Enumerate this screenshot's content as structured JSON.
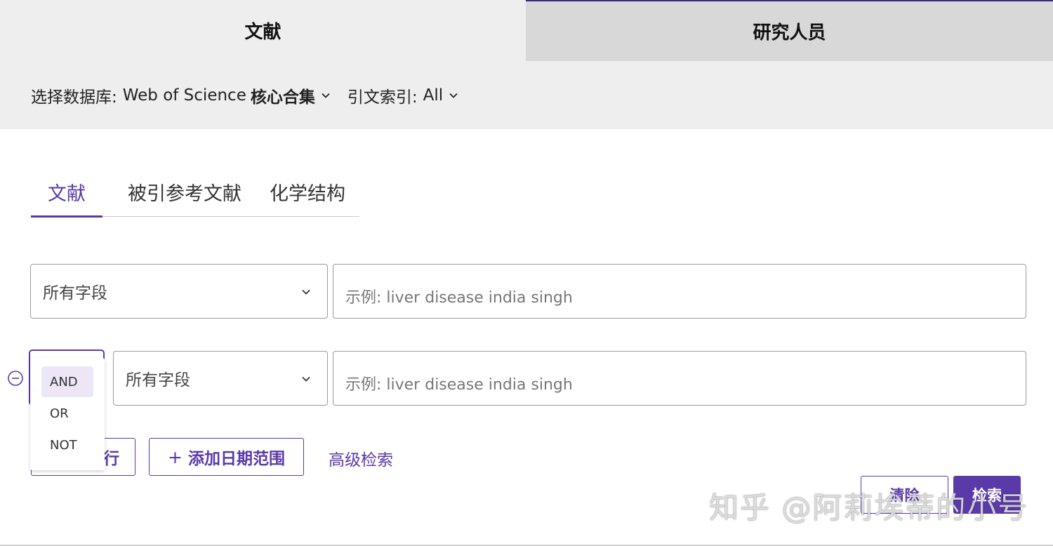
{
  "top_tabs": [
    {
      "label": "文献",
      "active": true
    },
    {
      "label": "研究人员",
      "active": false
    }
  ],
  "database_bar": {
    "db_label": "选择数据库:",
    "db_value_prefix": "Web of Science",
    "db_value_bold": "核心合集",
    "index_label": "引文索引:",
    "index_value": "All"
  },
  "sub_tabs": [
    {
      "label": "文献",
      "active": true
    },
    {
      "label": "被引参考文献",
      "active": false
    },
    {
      "label": "化学结构",
      "active": false
    }
  ],
  "rows": [
    {
      "field": "所有字段",
      "placeholder": "示例: liver disease india singh"
    },
    {
      "field": "所有字段",
      "placeholder": "示例: liver disease india singh",
      "operator": "AND"
    }
  ],
  "operator_options": [
    "AND",
    "OR",
    "NOT"
  ],
  "actions": {
    "add_row_visible": "行",
    "add_date_plus": "+",
    "add_date": "添加日期范围",
    "advanced": "高级检索",
    "clear": "清除",
    "search": "检索"
  },
  "watermark": "知乎 @阿莉埃蒂的小号",
  "colors": {
    "accent": "#5a3aa8",
    "tab_active_bg": "#eeeeee",
    "tab_inactive_bg": "#d8d8d8",
    "selected_option_bg": "#ece6f6"
  },
  "icons": {
    "caret": "chevron-down-icon",
    "remove": "minus-circle-icon"
  }
}
